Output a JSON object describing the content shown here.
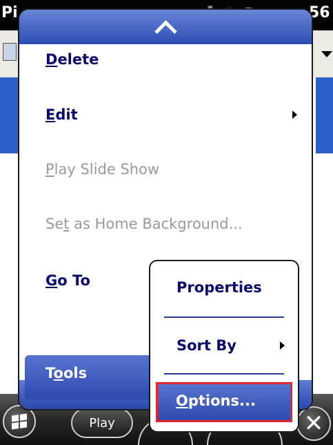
{
  "status_bar": {
    "app_title": "Pi",
    "clock": "56"
  },
  "main_menu": {
    "items": [
      {
        "accel": "D",
        "rest": "elete",
        "enabled": true
      },
      {
        "accel": "E",
        "rest": "dit",
        "enabled": true,
        "has_submenu": true
      },
      {
        "accel": "P",
        "rest": "lay Slide Show",
        "enabled": false
      },
      {
        "pre": "Se",
        "accel": "t",
        "rest": " as Home Background...",
        "enabled": false
      },
      {
        "accel": "G",
        "rest": "o To",
        "enabled": true
      },
      {
        "pre": "T",
        "accel": "o",
        "rest": "ols",
        "enabled": true,
        "selected": true
      }
    ]
  },
  "sub_menu": {
    "items": [
      {
        "accel": "P",
        "rest": "roperties"
      },
      {
        "accel": "S",
        "rest": "ort By",
        "has_submenu": true
      },
      {
        "accel": "O",
        "rest": "ptions...",
        "selected": true,
        "highlighted": true
      }
    ]
  },
  "softkeys": {
    "left_label": "Play"
  },
  "colors": {
    "menu_blue": "#2d49b0",
    "highlight_red": "#e8232a",
    "text_enabled": "#0a0a6e",
    "text_disabled": "#9a9a9a"
  }
}
